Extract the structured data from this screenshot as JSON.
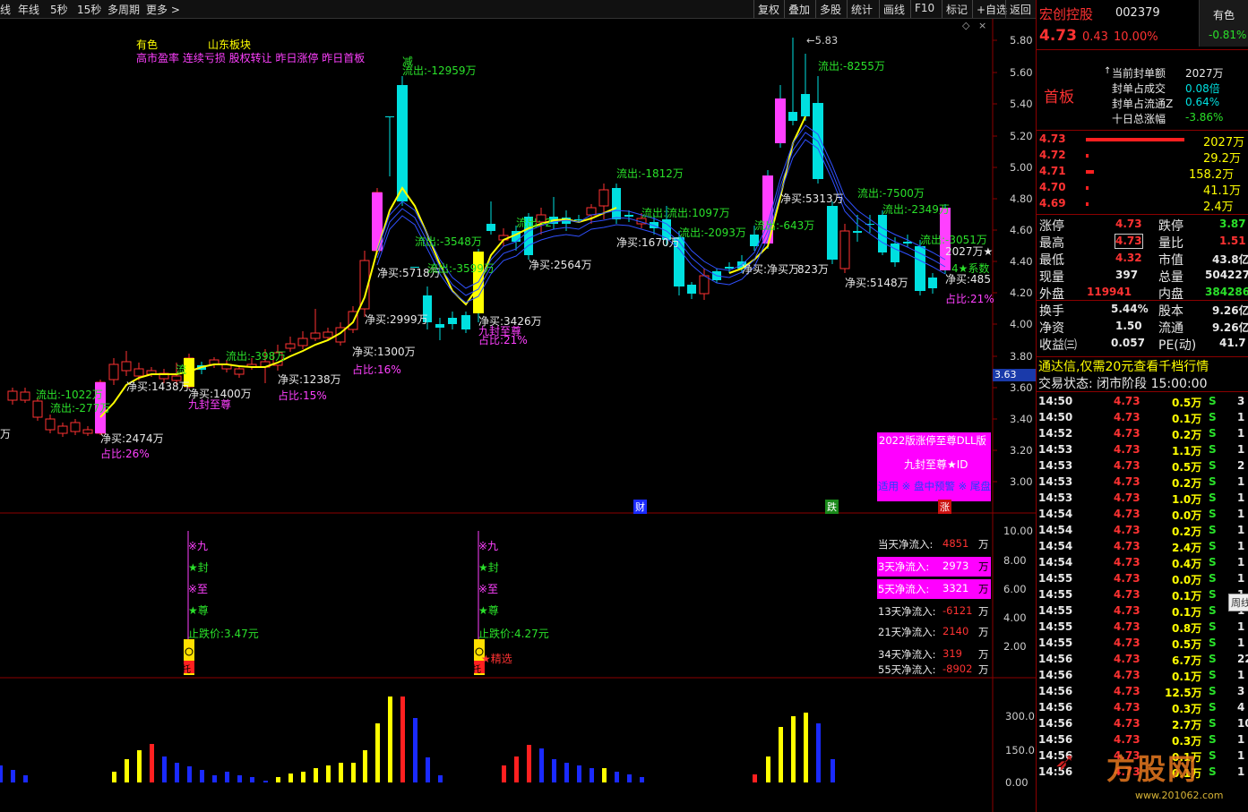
{
  "toolbar": {
    "left": [
      "线",
      "年线",
      "5秒",
      "15秒",
      "多周期",
      "更多 >"
    ],
    "right": [
      "复权",
      "叠加",
      "多股",
      "统计",
      "画线",
      "F10",
      "标记",
      "+自选",
      "返回"
    ]
  },
  "colors": {
    "up": "#ff3232",
    "down": "#00e0e0",
    "ma": "#ffff00",
    "ma2": "#3050ff",
    "vol_up": "#ffff00",
    "vol_red": "#ff2020",
    "vol_down": "#1a2aff",
    "grid": "#8b0000"
  },
  "main": {
    "price_axis": [
      "5.80",
      "5.60",
      "5.40",
      "5.20",
      "5.00",
      "4.80",
      "4.60",
      "4.40",
      "4.20",
      "4.00",
      "3.80",
      "3.60",
      "3.40",
      "3.20",
      "3.00"
    ],
    "current_price_tag": "3.63",
    "high_label": "5.83",
    "header_tags": {
      "a": "有色",
      "b": "山东板块"
    },
    "header_tags2": "高市盈率 连续亏损 股权转让 昨日涨停 昨日首板",
    "annotations": [
      {
        "t": "万",
        "c": "w"
      },
      {
        "t": "流出:-1022万",
        "c": "g"
      },
      {
        "t": "流出:-277万",
        "c": "g"
      },
      {
        "t": "净买:2474万",
        "c": "w"
      },
      {
        "t": "占比:26%",
        "c": "m"
      },
      {
        "t": "净买:1438万",
        "c": "w"
      },
      {
        "t": "流",
        "c": "g"
      },
      {
        "t": "净买:1400万",
        "c": "w"
      },
      {
        "t": "九封至尊",
        "c": "m"
      },
      {
        "t": "流出:-398万",
        "c": "g"
      },
      {
        "t": "净买:1238万",
        "c": "w"
      },
      {
        "t": "占比:15%",
        "c": "m"
      },
      {
        "t": "净买:1300万",
        "c": "w"
      },
      {
        "t": "占比:16%",
        "c": "m"
      },
      {
        "t": "净买:2999万",
        "c": "w"
      },
      {
        "t": "净买:5718万",
        "c": "w"
      },
      {
        "t": "减",
        "c": "g"
      },
      {
        "t": "流出:-12959万",
        "c": "g"
      },
      {
        "t": "流出:-3548万",
        "c": "g"
      },
      {
        "t": "流出:-3599万",
        "c": "g"
      },
      {
        "t": "净买:3426万",
        "c": "w"
      },
      {
        "t": "九封至尊",
        "c": "m"
      },
      {
        "t": "占比:21%",
        "c": "m"
      },
      {
        "t": "流出:-2",
        "c": "g"
      },
      {
        "t": "净买:2564万",
        "c": "w"
      },
      {
        "t": "流出:-1812万",
        "c": "g"
      },
      {
        "t": "净买:1670万",
        "c": "w"
      },
      {
        "t": "流出:流出:1097万",
        "c": "g"
      },
      {
        "t": "流出:-2093万",
        "c": "g"
      },
      {
        "t": "净买:净买万",
        "c": "w"
      },
      {
        "t": "流出:-643万",
        "c": "g"
      },
      {
        "t": "净买:5313万",
        "c": "w"
      },
      {
        "t": "823万",
        "c": "w"
      },
      {
        "t": "流出:-8255万",
        "c": "g"
      },
      {
        "t": "流出:-7500万",
        "c": "g"
      },
      {
        "t": "净买:5148万",
        "c": "w"
      },
      {
        "t": "流出:-2349万",
        "c": "g"
      },
      {
        "t": "流出:-3051万",
        "c": "g"
      },
      {
        "t": "2027万★",
        "c": "w"
      },
      {
        "t": "4★系数",
        "c": "g"
      },
      {
        "t": "净买:485",
        "c": "w"
      },
      {
        "t": "占比:21%",
        "c": "m"
      }
    ],
    "promo": {
      "line1": "2022版涨停至尊DLL版",
      "line2": "九封至尊★ID",
      "line3": "适用 ※ 盘中预警 ※ 尾盘"
    },
    "tags": {
      "cai": "财",
      "die": "跌",
      "zhang": "涨"
    }
  },
  "sub1": {
    "axis": [
      "10.00",
      "8.00",
      "6.00",
      "4.00",
      "2.00"
    ],
    "signal_left": {
      "lines": [
        "※九",
        "★封",
        "※至",
        "★尊"
      ],
      "stop": "止跌价:3.47元",
      "tuo": "托"
    },
    "signal_right": {
      "lines": [
        "※九",
        "★封",
        "※至",
        "★尊"
      ],
      "stop": "止跌价:4.27元",
      "pick": "★精选",
      "tuo": "托"
    },
    "flows": [
      {
        "label": "当天净流入:",
        "value": "4851",
        "unit": "万",
        "hl": false,
        "neg": false
      },
      {
        "label": "3天净流入:",
        "value": "2973",
        "unit": "万",
        "hl": true,
        "neg": false
      },
      {
        "label": "5天净流入:",
        "value": "3321",
        "unit": "万",
        "hl": true,
        "neg": false
      },
      {
        "label": "13天净流入:",
        "value": "-6121",
        "unit": "万",
        "hl": false,
        "neg": true
      },
      {
        "label": "21天净流入:",
        "value": "2140",
        "unit": "万",
        "hl": false,
        "neg": false
      },
      {
        "label": "34天净流入:",
        "value": "319",
        "unit": "万",
        "hl": false,
        "neg": false
      },
      {
        "label": "55天净流入:",
        "value": "-8902",
        "unit": "万",
        "hl": false,
        "neg": true
      }
    ]
  },
  "sub2": {
    "axis": [
      "300.0",
      "150.0",
      "0.00"
    ]
  },
  "right_panel": {
    "stock_name": "宏创控股",
    "stock_code": "002379",
    "sector": "有色",
    "sector_change": "-0.81%",
    "price": "4.73",
    "change": "0.43",
    "change_pct": "10.00%",
    "board": "首板",
    "seal": [
      {
        "k": "当前封单额",
        "v": "2027万",
        "c": "w"
      },
      {
        "k": "封单占成交",
        "v": "0.08倍",
        "c": "c"
      },
      {
        "k": "封单占流通Z",
        "v": "0.64%",
        "c": "c"
      },
      {
        "k": "十日总涨幅",
        "v": "-3.86%",
        "c": "g"
      }
    ],
    "bids": [
      {
        "p": "4.73",
        "v": "2027万",
        "bar": 100
      },
      {
        "p": "4.72",
        "v": "29.2万",
        "bar": 1.5
      },
      {
        "p": "4.71",
        "v": "158.2万",
        "bar": 8
      },
      {
        "p": "4.70",
        "v": "41.1万",
        "bar": 2
      },
      {
        "p": "4.69",
        "v": "2.4万",
        "bar": 0.5
      }
    ],
    "stats": [
      {
        "k1": "涨停",
        "v1": "4.73",
        "c1": "r",
        "k2": "跌停",
        "v2": "3.87",
        "c2": "g"
      },
      {
        "k1": "最高",
        "v1": "4.73",
        "c1": "r",
        "k2": "量比",
        "v2": "1.51",
        "c2": "r"
      },
      {
        "k1": "最低",
        "v1": "4.32",
        "c1": "r",
        "k2": "市值",
        "v2": "43.8亿",
        "c2": "w"
      },
      {
        "k1": "现量",
        "v1": "397",
        "c1": "w",
        "k2": "总量",
        "v2": "504227",
        "c2": "w"
      },
      {
        "k1": "外盘",
        "v1": "119941",
        "c1": "r",
        "k2": "内盘",
        "v2": "384286",
        "c2": "g"
      },
      {
        "k1": "换手",
        "v1": "5.44%",
        "c1": "w",
        "k2": "股本",
        "v2": "9.26亿",
        "c2": "w"
      },
      {
        "k1": "净资",
        "v1": "1.50",
        "c1": "w",
        "k2": "流通",
        "v2": "9.26亿",
        "c2": "w"
      },
      {
        "k1": "收益㈢",
        "v1": "0.057",
        "c1": "w",
        "k2": "PE(动)",
        "v2": "41.7",
        "c2": "w"
      }
    ],
    "ad": "通达信,仅需20元查看千档行情",
    "trade_state": "交易状态: 闭市阶段 15:00:00",
    "ticks": [
      {
        "t": "14:50",
        "p": "4.73",
        "v": "0.5万",
        "s": "S",
        "n": "3"
      },
      {
        "t": "14:50",
        "p": "4.73",
        "v": "0.1万",
        "s": "S",
        "n": "1"
      },
      {
        "t": "14:52",
        "p": "4.73",
        "v": "0.2万",
        "s": "S",
        "n": "1"
      },
      {
        "t": "14:53",
        "p": "4.73",
        "v": "1.1万",
        "s": "S",
        "n": "1"
      },
      {
        "t": "14:53",
        "p": "4.73",
        "v": "0.5万",
        "s": "S",
        "n": "2"
      },
      {
        "t": "14:53",
        "p": "4.73",
        "v": "0.2万",
        "s": "S",
        "n": "1"
      },
      {
        "t": "14:53",
        "p": "4.73",
        "v": "1.0万",
        "s": "S",
        "n": "1"
      },
      {
        "t": "14:54",
        "p": "4.73",
        "v": "0.0万",
        "s": "S",
        "n": "1"
      },
      {
        "t": "14:54",
        "p": "4.73",
        "v": "0.2万",
        "s": "S",
        "n": "1"
      },
      {
        "t": "14:54",
        "p": "4.73",
        "v": "2.4万",
        "s": "S",
        "n": "1"
      },
      {
        "t": "14:54",
        "p": "4.73",
        "v": "0.4万",
        "s": "S",
        "n": "1"
      },
      {
        "t": "14:55",
        "p": "4.73",
        "v": "0.0万",
        "s": "S",
        "n": "1"
      },
      {
        "t": "14:55",
        "p": "4.73",
        "v": "0.1万",
        "s": "S",
        "n": "1"
      },
      {
        "t": "14:55",
        "p": "4.73",
        "v": "0.1万",
        "s": "S",
        "n": "1"
      },
      {
        "t": "14:55",
        "p": "4.73",
        "v": "0.8万",
        "s": "S",
        "n": "1"
      },
      {
        "t": "14:55",
        "p": "4.73",
        "v": "0.5万",
        "s": "S",
        "n": "1"
      },
      {
        "t": "14:56",
        "p": "4.73",
        "v": "6.7万",
        "s": "S",
        "n": "22"
      },
      {
        "t": "14:56",
        "p": "4.73",
        "v": "0.1万",
        "s": "S",
        "n": "1"
      },
      {
        "t": "14:56",
        "p": "4.73",
        "v": "12.5万",
        "s": "S",
        "n": "3"
      },
      {
        "t": "14:56",
        "p": "4.73",
        "v": "0.3万",
        "s": "S",
        "n": "4"
      },
      {
        "t": "14:56",
        "p": "4.73",
        "v": "2.7万",
        "s": "S",
        "n": "10"
      },
      {
        "t": "14:56",
        "p": "4.73",
        "v": "0.3万",
        "s": "S",
        "n": "1"
      },
      {
        "t": "14:56",
        "p": "4.73",
        "v": "0.1万",
        "s": "S",
        "n": "1"
      },
      {
        "t": "14:56",
        "p": "4.73",
        "v": "0.1万",
        "s": "S",
        "n": "1"
      }
    ],
    "side_tag": "周线",
    "watermark": {
      "brand": "方股网",
      "url": "www.201062.com"
    }
  }
}
